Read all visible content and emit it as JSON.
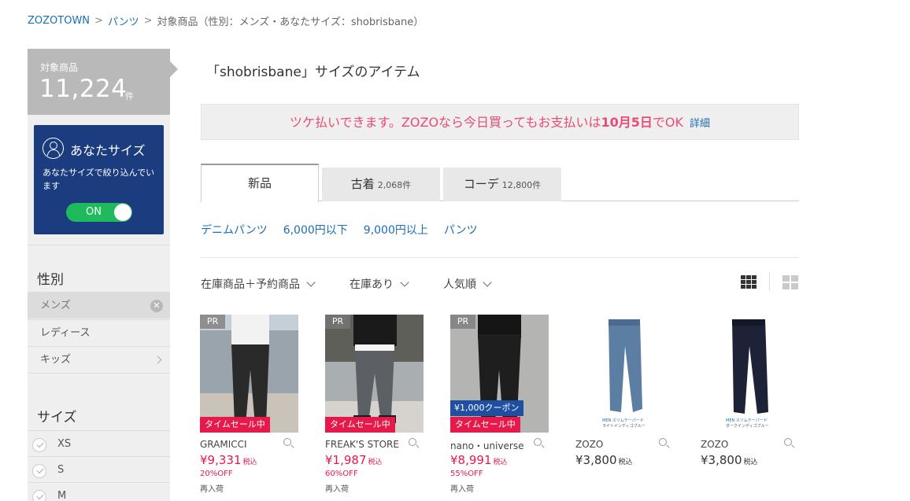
{
  "breadcrumb": {
    "home": "ZOZOTOWN",
    "category": "パンツ",
    "current": "対象商品（性別：メンズ・あなたサイズ：shobrisbane）",
    "sep": ">"
  },
  "sidebar": {
    "count_label": "対象商品",
    "count_value": "11,224",
    "count_unit": "件",
    "your_size": {
      "title": "あなたサイズ",
      "description": "あなたサイズで絞り込んでいます",
      "toggle": "ON"
    },
    "gender": {
      "heading": "性別",
      "items": [
        {
          "label": "メンズ"
        },
        {
          "label": "レディース"
        },
        {
          "label": "キッズ"
        }
      ],
      "clear_symbol": "✕"
    },
    "size": {
      "heading": "サイズ",
      "items": [
        {
          "label": "XS"
        },
        {
          "label": "S"
        },
        {
          "label": "M"
        }
      ]
    }
  },
  "main": {
    "title": "「shobrisbane」サイズのアイテム",
    "promo": {
      "text_before": "ツケ払いできます。ZOZOなら今日買ってもお支払いは",
      "date": "10月5日",
      "text_after": "でOK",
      "link": "詳細"
    },
    "tabs": [
      {
        "label": "新品",
        "count": ""
      },
      {
        "label": "古着",
        "count": "2,068件"
      },
      {
        "label": "コーデ",
        "count": "12,800件"
      }
    ],
    "quick_links": [
      "デニムパンツ",
      "6,000円以下",
      "9,000円以上",
      "パンツ"
    ],
    "filters": [
      "在庫商品＋予約商品",
      "在庫あり",
      "人気順"
    ],
    "products": [
      {
        "pr": "PR",
        "sale": "タイムセール中",
        "coupon": "",
        "brand": "GRAMICCI",
        "price": "¥9,331",
        "tax": "税込",
        "discount": "20%OFF",
        "note": "再入荷"
      },
      {
        "pr": "PR",
        "sale": "タイムセール中",
        "coupon": "",
        "brand": "FREAK'S STORE",
        "price": "¥1,987",
        "tax": "税込",
        "discount": "60%OFF",
        "note": "再入荷"
      },
      {
        "pr": "PR",
        "sale": "タイムセール中",
        "coupon": "¥1,000クーポン",
        "brand": "nano・universe",
        "price": "¥8,991",
        "tax": "税込",
        "discount": "55%OFF",
        "note": "再入荷"
      },
      {
        "pr": "",
        "sale": "",
        "coupon": "",
        "brand": "ZOZO",
        "price": "¥3,800",
        "tax": "税込",
        "discount": "",
        "note": "",
        "caption_1": "MEN スリムテーパード",
        "caption_2": "ライトインディゴブルー"
      },
      {
        "pr": "",
        "sale": "",
        "coupon": "",
        "brand": "ZOZO",
        "price": "¥3,800",
        "tax": "税込",
        "discount": "",
        "note": "",
        "caption_1": "MEN スリムテーパード",
        "caption_2": "ダークインディゴブルー"
      }
    ]
  },
  "colors": {
    "link": "#1a6eb5",
    "sale": "#e6194b",
    "promo": "#e84c73",
    "size_card": "#1b3d80",
    "toggle_on": "#1fba5c"
  },
  "icons": [
    "user-icon",
    "clear-icon",
    "chevron-right-icon",
    "check-icon",
    "chevron-down-icon",
    "grid-view-icon",
    "large-view-icon",
    "zoom-icon"
  ]
}
